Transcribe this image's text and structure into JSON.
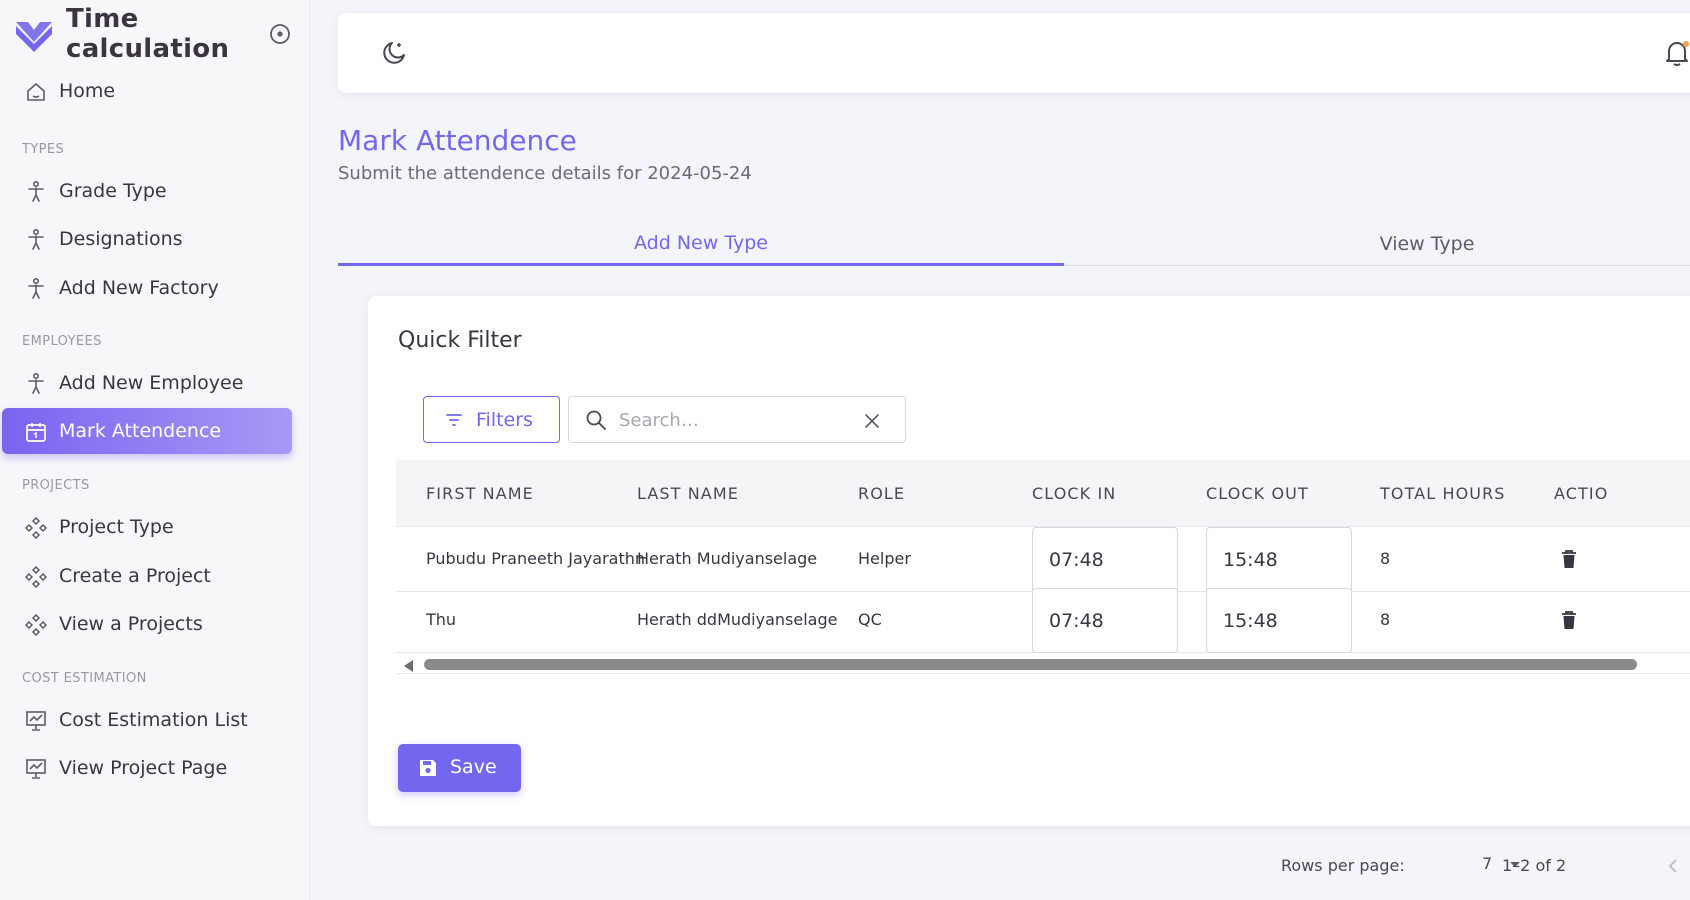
{
  "brand": {
    "title": "Time calculation",
    "accent": "#7367f0"
  },
  "sidebar": {
    "home": {
      "label": "Home",
      "icon": "home-icon"
    },
    "sections": [
      {
        "header": "TYPES",
        "items": [
          {
            "label": "Grade Type",
            "icon": "person-icon"
          },
          {
            "label": "Designations",
            "icon": "person-icon"
          },
          {
            "label": "Add New Factory",
            "icon": "person-icon"
          }
        ]
      },
      {
        "header": "EMPLOYEES",
        "items": [
          {
            "label": "Add New Employee",
            "icon": "person-icon"
          },
          {
            "label": "Mark Attendence",
            "icon": "calendar-icon",
            "active": true
          }
        ]
      },
      {
        "header": "PROJECTS",
        "items": [
          {
            "label": "Project Type",
            "icon": "diamonds-icon"
          },
          {
            "label": "Create a Project",
            "icon": "diamonds-icon"
          },
          {
            "label": "View a Projects",
            "icon": "diamonds-icon"
          }
        ]
      },
      {
        "header": "COST ESTIMATION",
        "items": [
          {
            "label": "Cost Estimation List",
            "icon": "chart-monitor-icon"
          },
          {
            "label": "View Project Page",
            "icon": "chart-monitor-icon"
          }
        ]
      }
    ]
  },
  "page": {
    "title": "Mark Attendence",
    "subtitle": "Submit the attendence details for 2024-05-24"
  },
  "tabs": [
    {
      "label": "Add New Type",
      "active": true
    },
    {
      "label": "View Type",
      "active": false
    }
  ],
  "card": {
    "title": "Quick Filter",
    "filters_label": "Filters",
    "search": {
      "placeholder": "Search…",
      "value": ""
    }
  },
  "table": {
    "columns": [
      "FIRST NAME",
      "LAST NAME",
      "ROLE",
      "CLOCK IN",
      "CLOCK OUT",
      "TOTAL HOURS",
      "ACTIO"
    ],
    "rows": [
      {
        "first_name": "Pubudu Praneeth Jayarathn",
        "last_name": "Herath Mudiyanselage",
        "role": "Helper",
        "clock_in": "07:48",
        "clock_out": "15:48",
        "total_hours": "8"
      },
      {
        "first_name": "Thu",
        "last_name": "Herath ddMudiyanselage",
        "role": "QC",
        "clock_in": "07:48",
        "clock_out": "15:48",
        "total_hours": "8"
      }
    ]
  },
  "pagination": {
    "rows_per_page_label": "Rows per page:",
    "rows_per_page": "7",
    "range": "1–2 of 2"
  },
  "save_label": "Save"
}
